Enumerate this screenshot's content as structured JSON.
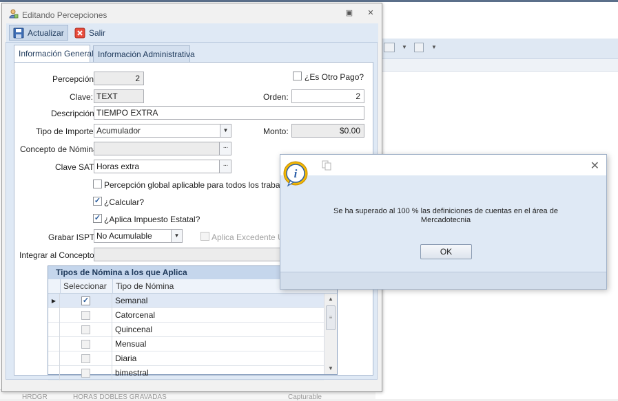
{
  "window": {
    "title": "Editando Percepciones"
  },
  "toolbar": {
    "update_label": "Actualizar",
    "exit_label": "Salir"
  },
  "tabs": [
    {
      "label": "Información General",
      "active": true
    },
    {
      "label": "Información Administrativa",
      "active": false
    }
  ],
  "form": {
    "percepcion_label": "Percepción:",
    "percepcion_value": "2",
    "otro_pago_label": "¿Es Otro Pago?",
    "otro_pago_checked": false,
    "clave_label": "Clave:",
    "clave_value": "TEXT",
    "orden_label": "Orden:",
    "orden_value": "2",
    "descripcion_label": "Descripción:",
    "descripcion_value": "TIEMPO EXTRA",
    "tipo_importe_label": "Tipo de Importe:",
    "tipo_importe_value": "Acumulador",
    "monto_label": "Monto:",
    "monto_value": "$0.00",
    "concepto_nomina_label": "Concepto de Nómina:",
    "concepto_nomina_value": "",
    "clave_sat_label": "Clave SAT:",
    "clave_sat_value": "Horas extra",
    "global_label": "Percepción global aplicable para todos los trabajadores",
    "global_checked": false,
    "calcular_label": "¿Calcular?",
    "calcular_checked": true,
    "impuesto_label": "¿Aplica Impuesto Estatal?",
    "impuesto_checked": true,
    "grabar_ispt_label": "Grabar ISPT:",
    "grabar_ispt_value": "No Acumulable",
    "excedente_label": "Aplica Excedente UM",
    "excedente_checked": false,
    "integrar_label": "Integrar al Concepto:",
    "integrar_value": ""
  },
  "grid": {
    "caption": "Tipos de Nómina a los que Aplica",
    "col_select": "Seleccionar",
    "col_type": "Tipo de Nómina",
    "rows": [
      {
        "name": "Semanal",
        "checked": true,
        "current": true
      },
      {
        "name": "Catorcenal",
        "checked": false,
        "current": false
      },
      {
        "name": "Quincenal",
        "checked": false,
        "current": false
      },
      {
        "name": "Mensual",
        "checked": false,
        "current": false
      },
      {
        "name": "Diaria",
        "checked": false,
        "current": false
      },
      {
        "name": "bimestral",
        "checked": false,
        "current": false
      }
    ]
  },
  "background": {
    "row_code": "HRDGR",
    "row_desc": "HORAS DOBLES GRAVADAS",
    "row_status": "Capturable"
  },
  "dialog": {
    "message_line1": "Se ha superado al 100 % las definiciones de cuentas en el área de",
    "message_line2": "Mercadotecnia",
    "ok_label": "OK"
  },
  "colors": {
    "accent": "#1e395b",
    "panel": "#dfe9f5",
    "check": "#2b5c9c",
    "info_icon": "#f2b705"
  },
  "icons": [
    "user-edit-icon",
    "restore-icon",
    "close-icon",
    "save-icon",
    "exit-icon",
    "info-icon",
    "copy-icon"
  ]
}
